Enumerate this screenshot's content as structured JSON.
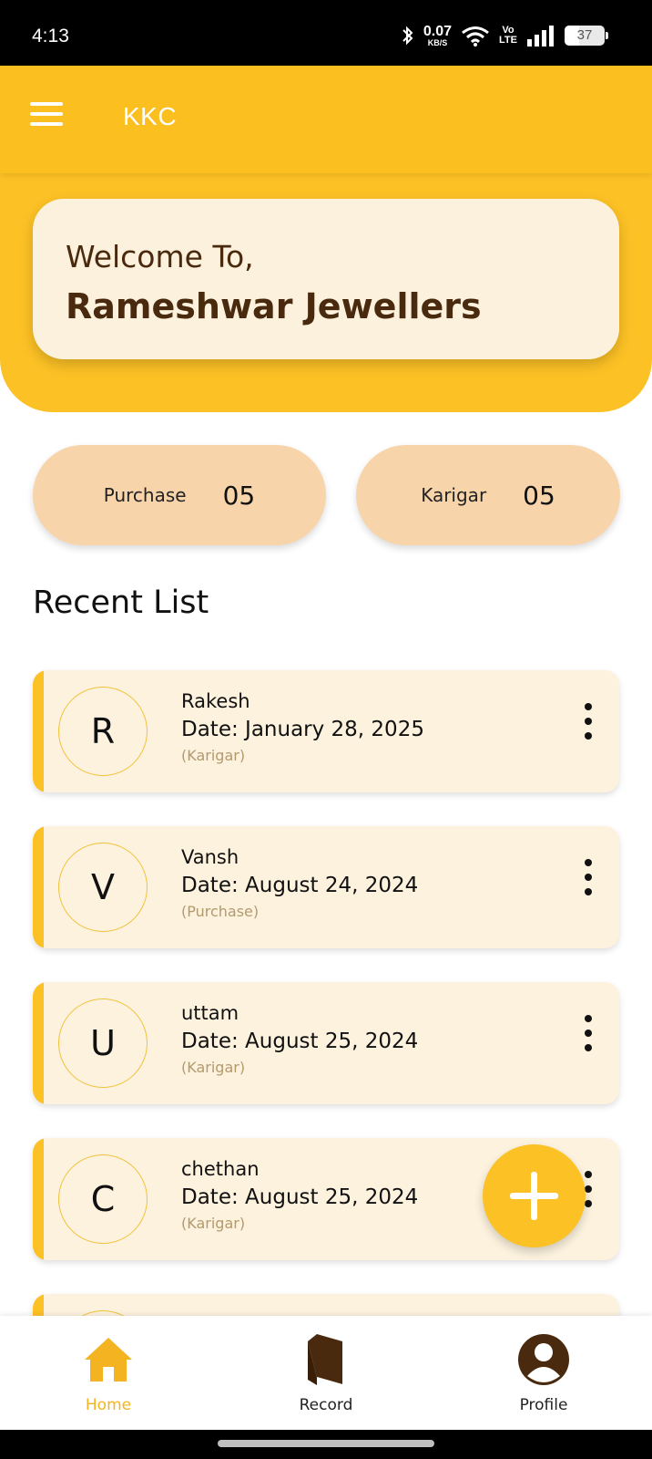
{
  "status_bar": {
    "time": "4:13",
    "net_speed_value": "0.07",
    "net_speed_unit": "KB/S",
    "volte_top": "Vo",
    "volte_bottom": "LTE",
    "battery": "37",
    "icons": [
      "bluetooth-icon",
      "wifi-icon",
      "signal-icon",
      "battery-icon"
    ]
  },
  "appbar": {
    "title": "KKC",
    "menu_icon": "hamburger-menu-icon"
  },
  "welcome": {
    "line1": "Welcome To,",
    "line2": "Rameshwar Jewellers"
  },
  "stats": [
    {
      "label": "Purchase",
      "value": "05"
    },
    {
      "label": "Karigar",
      "value": "05"
    }
  ],
  "recent": {
    "title": "Recent List",
    "items": [
      {
        "initial": "R",
        "name": "Rakesh",
        "date": "Date: January 28, 2025",
        "type": "(Karigar)"
      },
      {
        "initial": "V",
        "name": "Vansh",
        "date": "Date: August 24, 2024",
        "type": "(Purchase)"
      },
      {
        "initial": "U",
        "name": "uttam",
        "date": "Date: August 25, 2024",
        "type": "(Karigar)"
      },
      {
        "initial": "C",
        "name": "chethan",
        "date": "Date: August 25, 2024",
        "type": "(Karigar)"
      }
    ]
  },
  "fab": {
    "icon": "plus-icon"
  },
  "bottom_nav": {
    "items": [
      {
        "label": "Home",
        "icon": "home-icon",
        "active": true
      },
      {
        "label": "Record",
        "icon": "book-icon",
        "active": false
      },
      {
        "label": "Profile",
        "icon": "profile-icon",
        "active": false
      }
    ]
  },
  "colors": {
    "primary": "#fcc125",
    "card": "#fcf2de",
    "welcome_card": "#fcf1dc",
    "stat_pill": "#f8d4ab",
    "brown": "#4a2a0e",
    "active_nav": "#f4b421"
  }
}
